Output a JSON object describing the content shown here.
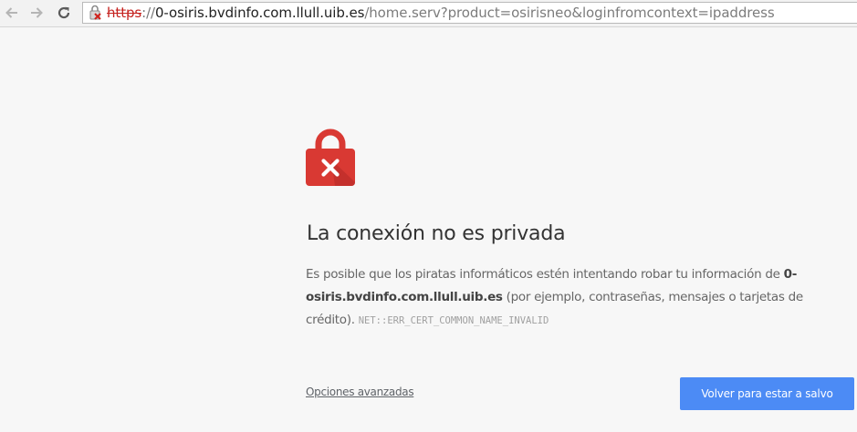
{
  "browser": {
    "nav": {
      "back_icon": "arrow-left-icon",
      "forward_icon": "arrow-right-icon",
      "reload_icon": "reload-icon"
    },
    "omnibox": {
      "security_icon": "broken-lock-icon",
      "scheme": "https",
      "separator": "://",
      "host": "0-osiris.bvdinfo.com.llull.uib.es",
      "path": "/home.serv?product=osirisneo&loginfromcontext=ipaddress"
    }
  },
  "interstitial": {
    "icon": "red-padlock-x-icon",
    "title": "La conexión no es privada",
    "body_before": "Es posible que los piratas informáticos estén intentando robar tu información de ",
    "body_host": "0-osiris.bvdinfo.com.llull.uib.es",
    "body_after": " (por ejemplo, contraseñas, mensajes o tarjetas de crédito). ",
    "error_code": "NET::ERR_CERT_COMMON_NAME_INVALID",
    "advanced_label": "Opciones avanzadas",
    "back_to_safety_label": "Volver para estar a salvo"
  },
  "colors": {
    "page_background": "#f7f7f7",
    "danger_red": "#d93933",
    "primary_button": "#4c8bf5"
  }
}
